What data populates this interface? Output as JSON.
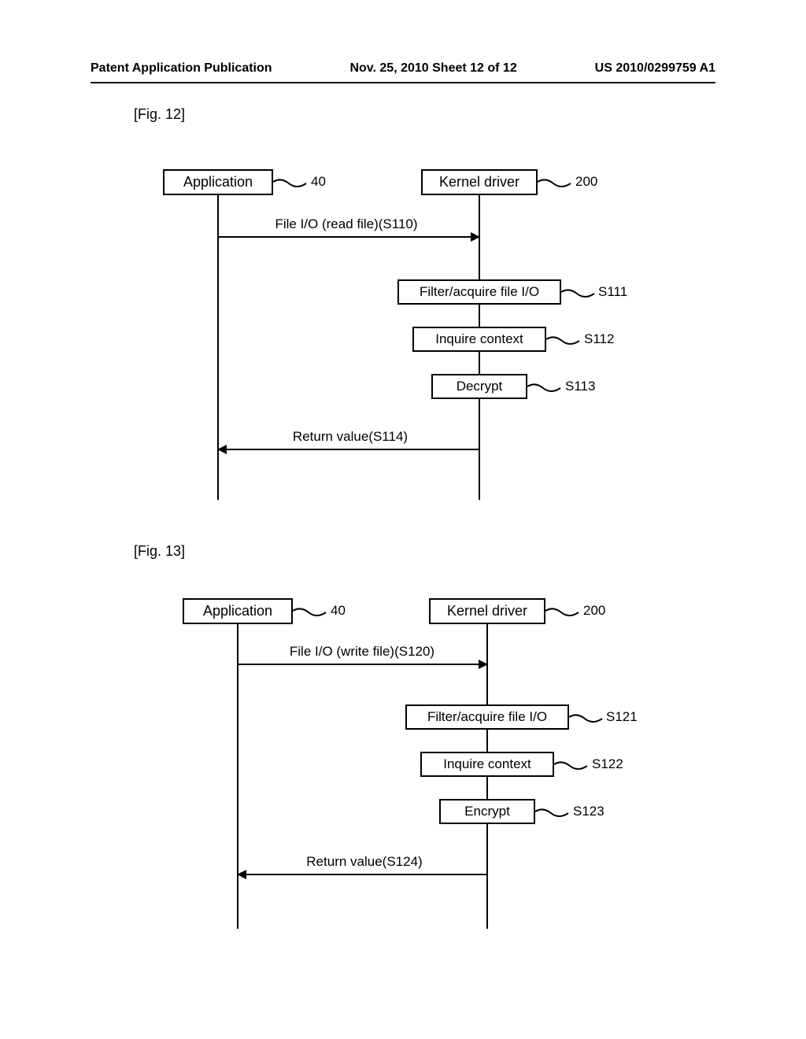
{
  "header": {
    "left": "Patent Application Publication",
    "center": "Nov. 25, 2010  Sheet 12 of 12",
    "right": "US 2010/0299759 A1"
  },
  "fig12": {
    "label": "[Fig. 12]",
    "app_box": "Application",
    "app_ref": "40",
    "kernel_box": "Kernel driver",
    "kernel_ref": "200",
    "msg1": "File I/O (read file)(S110)",
    "step1": "Filter/acquire file I/O",
    "step1_ref": "S111",
    "step2": "Inquire context",
    "step2_ref": "S112",
    "step3": "Decrypt",
    "step3_ref": "S113",
    "msg2": "Return value(S114)"
  },
  "fig13": {
    "label": "[Fig. 13]",
    "app_box": "Application",
    "app_ref": "40",
    "kernel_box": "Kernel driver",
    "kernel_ref": "200",
    "msg1": "File I/O (write file)(S120)",
    "step1": "Filter/acquire file I/O",
    "step1_ref": "S121",
    "step2": "Inquire context",
    "step2_ref": "S122",
    "step3": "Encrypt",
    "step3_ref": "S123",
    "msg2": "Return value(S124)"
  }
}
